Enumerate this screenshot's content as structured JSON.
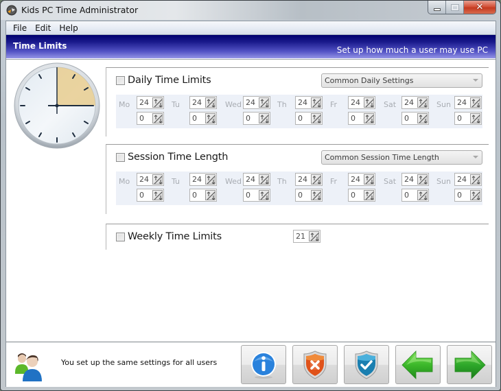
{
  "window": {
    "title": "Kids PC Time Administrator",
    "controls": {
      "minimize": "minimize",
      "maximize": "maximize",
      "close": "✕"
    }
  },
  "menu": {
    "items": [
      {
        "label": "File"
      },
      {
        "label": "Edit"
      },
      {
        "label": "Help"
      }
    ]
  },
  "header": {
    "title": "Time Limits",
    "subtitle": "Set up how much a user may use PC"
  },
  "clock": {
    "icon": "clock-icon",
    "highlight_color": "#e8cc8f"
  },
  "daily": {
    "label": "Daily Time Limits",
    "checked": false,
    "preset": "Common Daily Settings",
    "days": [
      {
        "label": "Mo",
        "hours": "24",
        "minutes": "0"
      },
      {
        "label": "Tu",
        "hours": "24",
        "minutes": "0"
      },
      {
        "label": "Wed",
        "hours": "24",
        "minutes": "0"
      },
      {
        "label": "Th",
        "hours": "24",
        "minutes": "0"
      },
      {
        "label": "Fr",
        "hours": "24",
        "minutes": "0"
      },
      {
        "label": "Sat",
        "hours": "24",
        "minutes": "0"
      },
      {
        "label": "Sun",
        "hours": "24",
        "minutes": "0"
      }
    ]
  },
  "session": {
    "label": "Session Time Length",
    "checked": false,
    "preset": "Common Session Time Length",
    "days": [
      {
        "label": "Mo",
        "hours": "24",
        "minutes": "0"
      },
      {
        "label": "Tu",
        "hours": "24",
        "minutes": "0"
      },
      {
        "label": "Wed",
        "hours": "24",
        "minutes": "0"
      },
      {
        "label": "Th",
        "hours": "24",
        "minutes": "0"
      },
      {
        "label": "Fr",
        "hours": "24",
        "minutes": "0"
      },
      {
        "label": "Sat",
        "hours": "24",
        "minutes": "0"
      },
      {
        "label": "Sun",
        "hours": "24",
        "minutes": "0"
      }
    ]
  },
  "weekly": {
    "label": "Weekly Time Limits",
    "checked": false,
    "value": "21"
  },
  "footer": {
    "status_text": "You set up the same settings for all users",
    "buttons": [
      {
        "name": "info",
        "icon": "info-icon"
      },
      {
        "name": "reject",
        "icon": "shield-x-icon"
      },
      {
        "name": "accept",
        "icon": "shield-check-icon"
      },
      {
        "name": "back",
        "icon": "arrow-left-icon"
      },
      {
        "name": "next",
        "icon": "arrow-right-icon"
      }
    ]
  },
  "colors": {
    "header_dark": "#00006e",
    "header_light": "#9494e6",
    "days_panel_bg": "#edf1f8",
    "close_button": "#c43a20"
  }
}
